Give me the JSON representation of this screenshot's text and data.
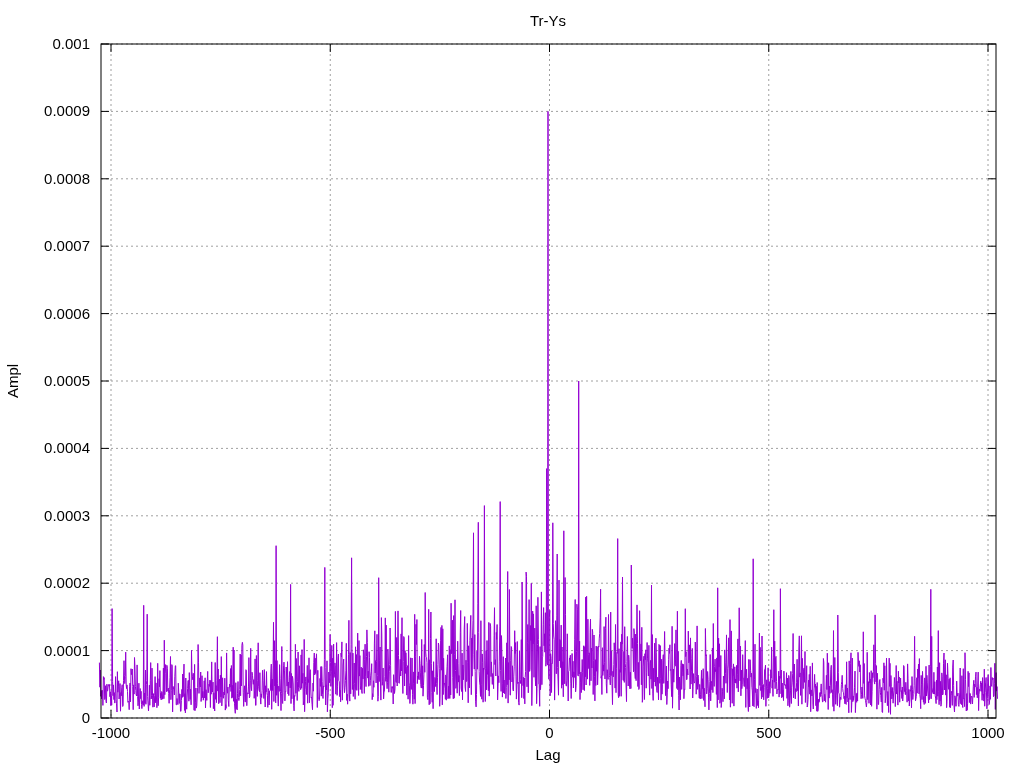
{
  "plot": {
    "title": "Tr-Ys",
    "xlabel": "Lag",
    "ylabel": "Ampl",
    "xticks": [
      "-1000",
      "-500",
      "0",
      "500",
      "1000"
    ],
    "yticks": [
      "0.001",
      "0.0009",
      "0.0008",
      "0.0007",
      "0.0006",
      "0.0005",
      "0.0004",
      "0.0003",
      "0.0002",
      "0.0001",
      "0"
    ]
  }
}
